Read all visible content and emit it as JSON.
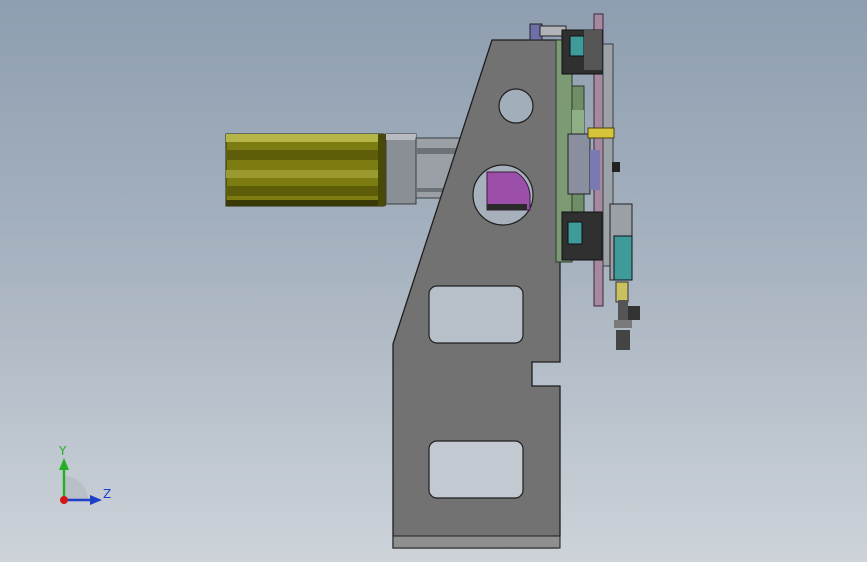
{
  "viewport": {
    "background_top": "#8e9eb0",
    "background_bottom": "#cdd3d9"
  },
  "triad": {
    "y_label": "Y",
    "z_label": "Z",
    "y_color": "#22b022",
    "z_color": "#1e3fc8",
    "x_color": "#d01818"
  },
  "model_colors": {
    "bracket": "#6f6f6f",
    "motor": "#7f7f10",
    "plate_green": "#7a9a72",
    "magenta": "#9b4fa8",
    "teal": "#3f9a9a",
    "rail_pink": "#a889a3"
  }
}
